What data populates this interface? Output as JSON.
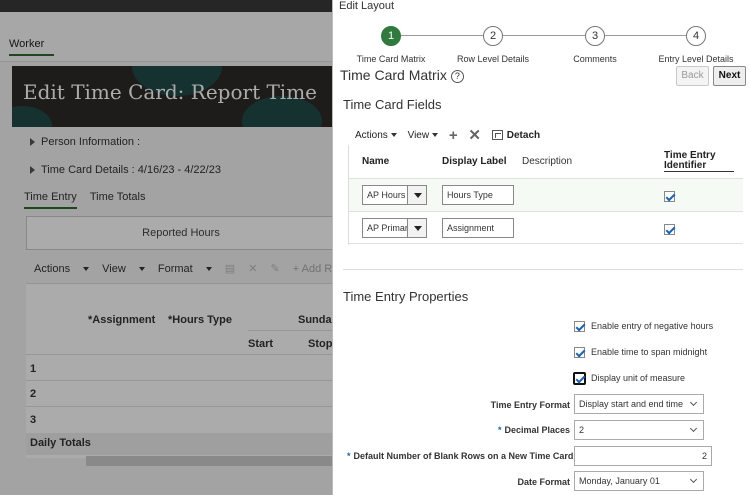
{
  "background": {
    "tab_worker": "Worker",
    "banner_title": "Edit Time Card: Report Time",
    "person_information": "Person Information :",
    "time_card_details": "Time Card Details : 4/16/23 - 4/22/23",
    "subtabs": [
      "Time Entry",
      "Time Totals"
    ],
    "reported_hours": "Reported Hours",
    "toolbar": {
      "actions": "Actions",
      "view": "View",
      "format": "Format",
      "add_row": "Add Row Be"
    },
    "table": {
      "col_assignment": "*Assignment",
      "col_hours_type": "*Hours Type",
      "col_day": "Sunda",
      "col_start": "Start",
      "col_stop": "Stop",
      "rows": [
        "1",
        "2",
        "3"
      ],
      "daily_totals": "Daily Totals"
    }
  },
  "dialog": {
    "title": "Edit Layout",
    "steps": [
      {
        "number": "1",
        "label": "Time Card Matrix",
        "current": true
      },
      {
        "number": "2",
        "label": "Row Level Details",
        "current": false
      },
      {
        "number": "3",
        "label": "Comments",
        "current": false
      },
      {
        "number": "4",
        "label": "Entry Level Details",
        "current": false
      }
    ],
    "section_title": "Time Card Matrix",
    "back_label": "Back",
    "next_label": "Next",
    "fields_heading": "Time Card Fields",
    "fields_toolbar": {
      "actions": "Actions",
      "view": "View",
      "detach": "Detach"
    },
    "fields_columns": {
      "name": "Name",
      "display_label": "Display Label",
      "description": "Description",
      "identifier": "Time Entry Identifier"
    },
    "fields_rows": [
      {
        "name": "AP Hours",
        "display_label": "Hours Type",
        "description": "",
        "identifier": true
      },
      {
        "name": "AP Primar",
        "display_label": "Assignment",
        "description": "",
        "identifier": true
      }
    ],
    "properties_heading": "Time Entry Properties",
    "properties": {
      "negative_hours": {
        "label": "Enable entry of negative hours",
        "checked": true
      },
      "span_midnight": {
        "label": "Enable time to span midnight",
        "checked": true
      },
      "display_unit": {
        "label": "Display unit of measure",
        "checked": true
      }
    },
    "time_entry_format": {
      "label": "Time Entry Format",
      "value": "Display start and end time"
    },
    "decimal_places": {
      "label": "Decimal Places",
      "value": "2",
      "required": "*"
    },
    "blank_rows": {
      "label": "Default Number of Blank Rows on a New Time Card",
      "value": "2",
      "required": "*"
    },
    "date_format": {
      "label": "Date Format",
      "value": "Monday, January 01"
    }
  },
  "colors": {
    "accent": "#2f7a3c",
    "check": "#1a62b8"
  }
}
